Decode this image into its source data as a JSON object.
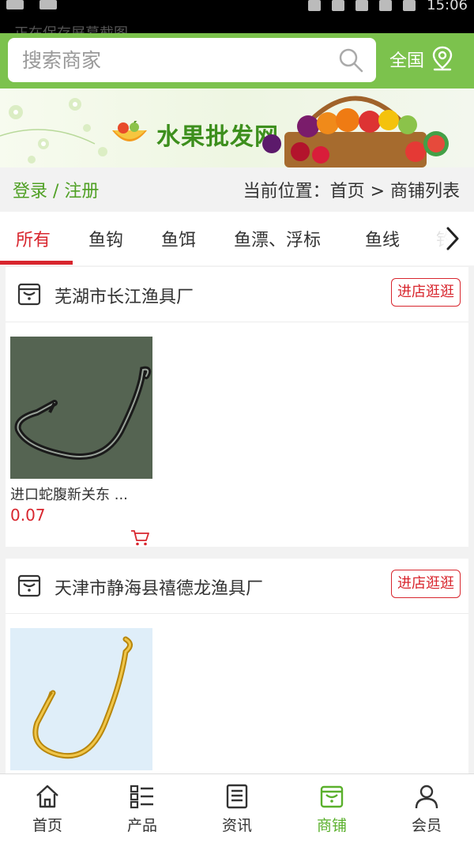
{
  "status_bar": {
    "time": "15:06",
    "notice": "正在保存屏幕截图..."
  },
  "search": {
    "placeholder": "搜索商家"
  },
  "region": {
    "label": "全国"
  },
  "banner": {
    "title": "水果批发网"
  },
  "auth": {
    "label": "登录 / 注册"
  },
  "breadcrumb": {
    "text": "当前位置：首页 > 商铺列表"
  },
  "tabs": [
    {
      "label": "所有",
      "active": true
    },
    {
      "label": "鱼钩"
    },
    {
      "label": "鱼饵"
    },
    {
      "label": "鱼漂、浮标"
    },
    {
      "label": "鱼线"
    },
    {
      "label": "钓"
    }
  ],
  "stores": [
    {
      "name": "芜湖市长江渔具厂",
      "visit_label": "进店逛逛",
      "products": [
        {
          "name": "进口蛇腹新关东 ...",
          "price": "0.07"
        }
      ]
    },
    {
      "name": "天津市静海县禧德龙渔具厂",
      "visit_label": "进店逛逛",
      "products": [
        {
          "name": "",
          "price": ""
        }
      ]
    }
  ],
  "bottom_nav": [
    {
      "label": "首页",
      "icon": "home-icon"
    },
    {
      "label": "产品",
      "icon": "list-icon"
    },
    {
      "label": "资讯",
      "icon": "news-icon"
    },
    {
      "label": "商铺",
      "icon": "store-icon",
      "active": true
    },
    {
      "label": "会员",
      "icon": "user-icon"
    }
  ],
  "colors": {
    "accent_green": "#7cc24d",
    "accent_red": "#d8262e",
    "active_nav": "#5ab02c"
  }
}
